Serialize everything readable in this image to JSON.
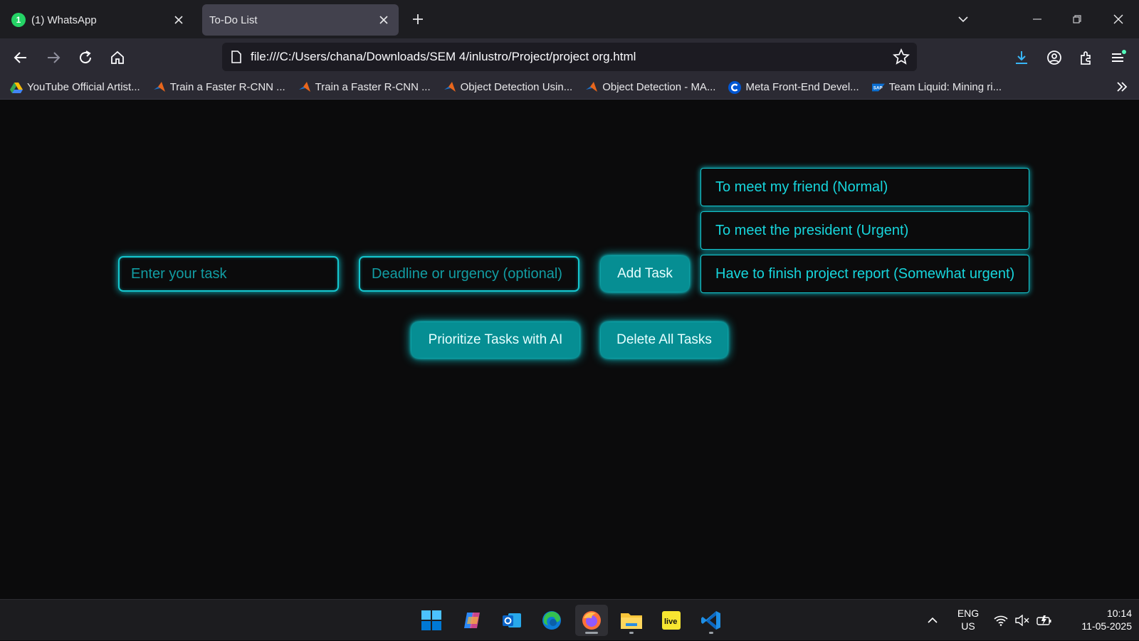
{
  "tabs": [
    {
      "title": "(1) WhatsApp",
      "badge": "1"
    },
    {
      "title": "To-Do List"
    }
  ],
  "navbar": {
    "url": "file:///C:/Users/chana/Downloads/SEM 4/inlustro/Project/project org.html"
  },
  "bookmarks": [
    {
      "label": "YouTube Official Artist...",
      "icon": "google-drive-icon"
    },
    {
      "label": "Train a Faster R-CNN ...",
      "icon": "matlab-icon"
    },
    {
      "label": "Train a Faster R-CNN ...",
      "icon": "matlab-icon"
    },
    {
      "label": "Object Detection Usin...",
      "icon": "matlab-icon"
    },
    {
      "label": "Object Detection - MA...",
      "icon": "matlab-icon"
    },
    {
      "label": "Meta Front-End Devel...",
      "icon": "coursera-icon"
    },
    {
      "label": "Team Liquid: Mining ri...",
      "icon": "sap-icon"
    }
  ],
  "todo": {
    "task_placeholder": "Enter your task",
    "deadline_placeholder": "Deadline or urgency (optional)",
    "add_label": "Add Task",
    "prioritize_label": "Prioritize Tasks with AI",
    "delete_label": "Delete All Tasks",
    "tasks": [
      "To meet my friend (Normal)",
      "To meet the president (Urgent)",
      "Have to finish project report (Somewhat urgent)"
    ]
  },
  "taskbar": {
    "lang_line1": "ENG",
    "lang_line2": "US",
    "time": "10:14",
    "date": "11-05-2025"
  },
  "colors": {
    "accent": "#15c7cf",
    "button_fill": "#068e93",
    "page_bg": "#0b0b0c"
  }
}
